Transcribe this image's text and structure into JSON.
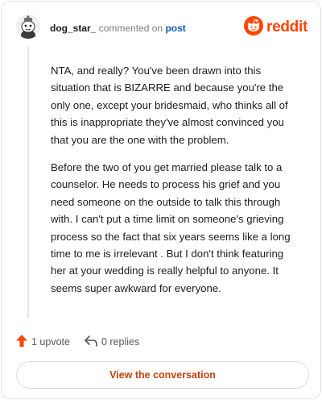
{
  "header": {
    "username": "dog_star_",
    "commented_on": "commented on",
    "post_link": "post",
    "brand": "reddit"
  },
  "comment": {
    "paragraphs": [
      "NTA, and really? You've been drawn into this situation that is BIZARRE and because you're the only one, except your bridesmaid, who thinks all of this is inappropriate they've almost convinced you that you are the one with the problem.",
      "Before the two of you get married please talk to a counselor. He needs to process his grief and you need someone on the outside to talk this through with. I can't put a time limit on someone's grieving process so the fact that six years seems like a long time to me is irrelevant . But I don't think featuring her at your wedding is really helpful to anyone. It seems super awkward for everyone."
    ]
  },
  "actions": {
    "upvote_label": "1 upvote",
    "replies_label": "0 replies"
  },
  "cta": {
    "label": "View the conversation"
  },
  "colors": {
    "accent": "#ff4500",
    "link": "#0b5fb8",
    "cta_text": "#c2410c"
  },
  "icons": {
    "avatar": "snoo-avatar-icon",
    "brand": "reddit-logo-icon",
    "upvote": "upvote-arrow-icon",
    "reply": "reply-icon"
  }
}
